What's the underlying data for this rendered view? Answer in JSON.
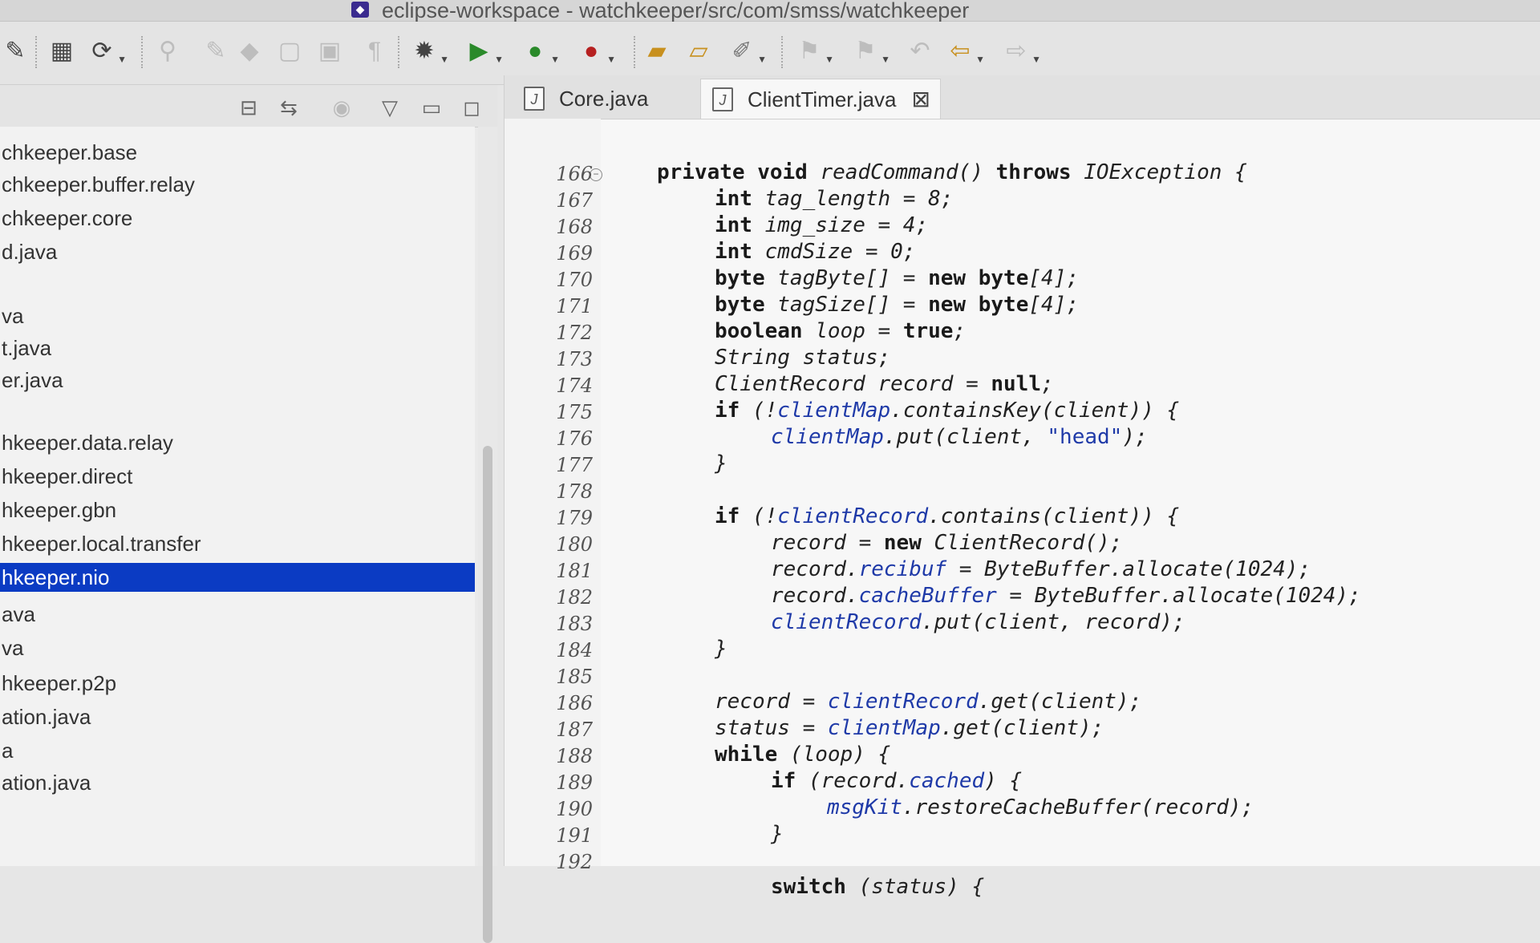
{
  "window": {
    "title": "eclipse-workspace - watchkeeper/src/com/smss/watchkeeper"
  },
  "toolbar": {
    "icons": [
      "skip-icon",
      "package-icon",
      "refresh-icon",
      "pin-icon",
      "debug-icon",
      "run-icon",
      "coverage-icon",
      "external-tools-icon",
      "open-type-icon",
      "open-folder-icon",
      "search-icon",
      "back-icon",
      "forward-icon"
    ]
  },
  "explorer": {
    "items": [
      "chkeeper.base",
      "chkeeper.buffer.relay",
      "chkeeper.core",
      "d.java",
      "va",
      "t.java",
      "er.java",
      "hkeeper.data.relay",
      "hkeeper.direct",
      "hkeeper.gbn",
      "hkeeper.local.transfer",
      "hkeeper.nio",
      "ava",
      "va",
      "hkeeper.p2p",
      "ation.java",
      "a",
      "ation.java"
    ],
    "selected_index": 11
  },
  "editor": {
    "tabs": [
      {
        "label": "Core.java",
        "active": false
      },
      {
        "label": "ClientTimer.java",
        "active": true
      }
    ],
    "line_numbers": [
      "166",
      "167",
      "168",
      "169",
      "170",
      "171",
      "172",
      "173",
      "174",
      "175",
      "176",
      "177",
      "178",
      "179",
      "180",
      "181",
      "182",
      "183",
      "184",
      "185",
      "186",
      "187",
      "188",
      "189",
      "190",
      "191",
      "192"
    ]
  },
  "colors": {
    "selection": "#0b3bc3",
    "keyword": "#1a1a1a",
    "field": "#1f3aa8"
  }
}
